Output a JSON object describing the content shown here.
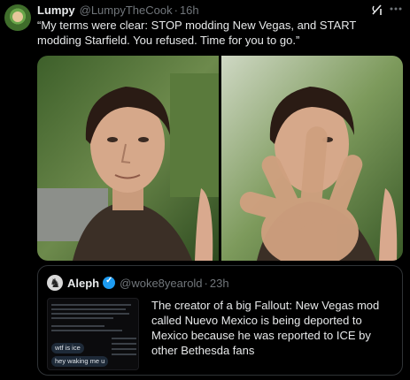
{
  "tweet": {
    "author_name": "Lumpy",
    "author_handle": "@LumpyTheCook",
    "separator": "·",
    "time": "16h",
    "text": "“My terms were clear: STOP modding New Vegas, and START modding Starfield. You refused. Time for you to go.”",
    "icons": {
      "grok": "grok-icon",
      "more": "more-options-icon"
    }
  },
  "quote": {
    "author_name": "Aleph",
    "author_handle": "@woke8yearold",
    "separator": "·",
    "time": "23h",
    "text": "The creator of a big Fallout: New Vegas mod called Nuevo Mexico is being deported to Mexico because he was reported to ICE by other Bethesda fans",
    "thumbnail": {
      "pill_1": "wtf is ice",
      "pill_2": "hey waking me u"
    }
  },
  "colors": {
    "background": "#000000",
    "text_primary": "#e7e9ea",
    "text_secondary": "#71767b",
    "border": "#2f3336",
    "verified": "#1d9bf0"
  }
}
